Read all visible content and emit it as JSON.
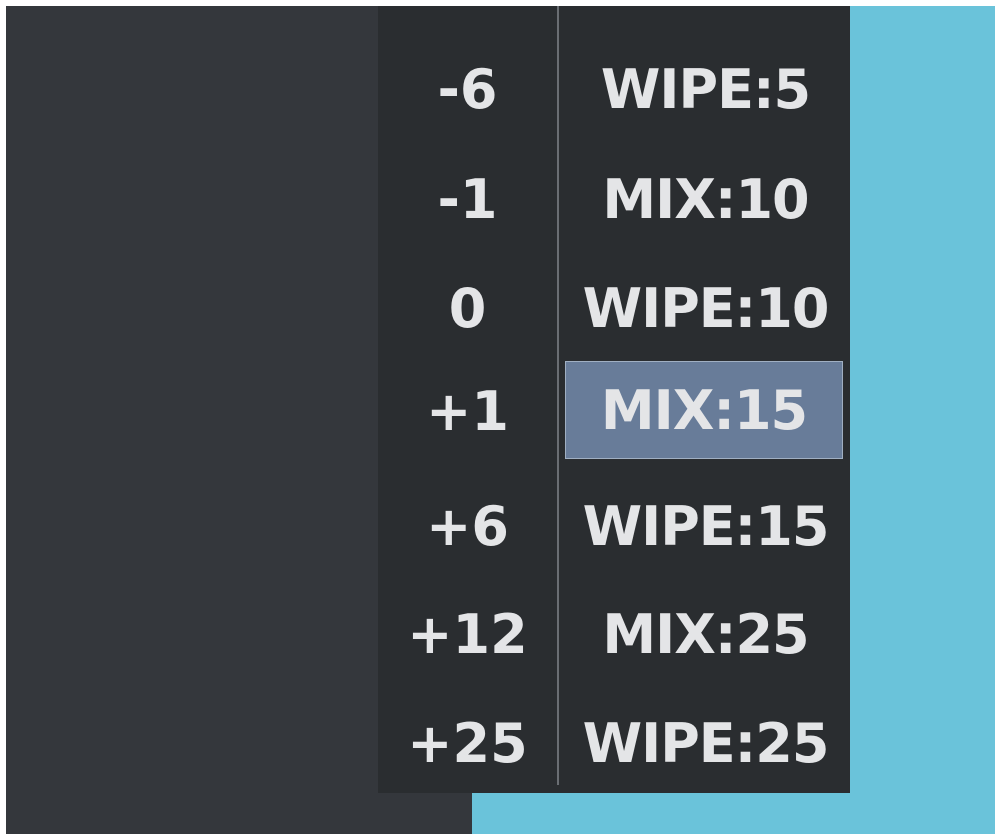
{
  "colors": {
    "panel_background": "#34373c",
    "popup_background": "#2a2d30",
    "accent_cyan": "#6ac3da",
    "selection_fill": "#687c99",
    "text": "#e4e5e7"
  },
  "transition_list": {
    "selected_index": 3,
    "rows": [
      {
        "offset": "-6",
        "label": "WIPE:5"
      },
      {
        "offset": "-1",
        "label": "MIX:10"
      },
      {
        "offset": "0",
        "label": "WIPE:10"
      },
      {
        "offset": "+1",
        "label": "MIX:15"
      },
      {
        "offset": "+6",
        "label": "WIPE:15"
      },
      {
        "offset": "+12",
        "label": "MIX:25"
      },
      {
        "offset": "+25",
        "label": "WIPE:25"
      }
    ]
  }
}
